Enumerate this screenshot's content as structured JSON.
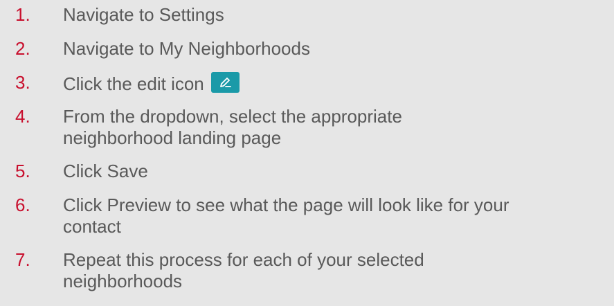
{
  "colors": {
    "background": "#e6e6e6",
    "number": "#c8102e",
    "text": "#595959",
    "edit_button": "#1a9aa8"
  },
  "steps": [
    {
      "number": "1.",
      "lines": [
        "Navigate to Settings"
      ]
    },
    {
      "number": "2.",
      "lines": [
        "Navigate to My Neighborhoods"
      ]
    },
    {
      "number": "3.",
      "lines": [
        "Click the edit icon"
      ],
      "icon": "pencil-icon"
    },
    {
      "number": "4.",
      "lines": [
        "From the dropdown, select the appropriate",
        "neighborhood landing page"
      ]
    },
    {
      "number": "5.",
      "lines": [
        "Click Save"
      ]
    },
    {
      "number": "6.",
      "lines": [
        "Click Preview to see what the page will look like for your",
        "contact"
      ]
    },
    {
      "number": "7.",
      "lines": [
        "Repeat this process for each of your selected",
        "neighborhoods"
      ]
    }
  ]
}
